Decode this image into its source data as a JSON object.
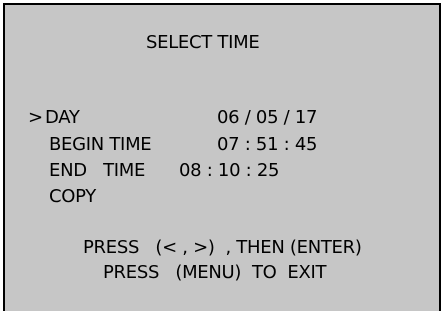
{
  "menu": {
    "title": "SELECT TIME",
    "cursor": ">",
    "items": [
      {
        "label": "DAY",
        "value": "06 / 05 / 17"
      },
      {
        "label": "BEGIN TIME",
        "value": "07 : 51 : 45"
      },
      {
        "label": "END   TIME",
        "value": "08 : 10 : 25"
      },
      {
        "label": "COPY",
        "value": ""
      }
    ],
    "selected_index": 0
  },
  "instructions": {
    "line1": "PRESS   (< , >)  , THEN (ENTER)",
    "line2": "PRESS   (MENU)  TO  EXIT"
  },
  "colors": {
    "background": "#c6c6c6",
    "border": "#000000",
    "text": "#000000"
  }
}
